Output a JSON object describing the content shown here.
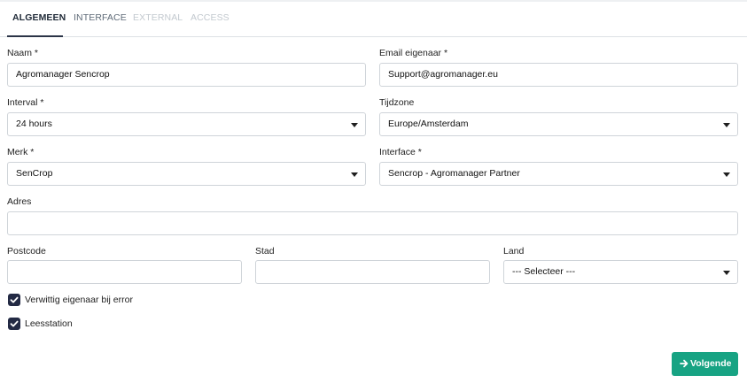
{
  "tabs": [
    {
      "label": "ALGEMEEN",
      "state": "active"
    },
    {
      "label": "INTERFACE",
      "state": "normal"
    },
    {
      "label": "EXTERNAL",
      "state": "disabled"
    },
    {
      "label": "ACCESS",
      "state": "disabled"
    }
  ],
  "form": {
    "naam": {
      "label": "Naam *",
      "value": "Agromanager Sencrop"
    },
    "email": {
      "label": "Email eigenaar *",
      "value": "Support@agromanager.eu"
    },
    "interval": {
      "label": "Interval *",
      "value": "24 hours"
    },
    "tijdzone": {
      "label": "Tijdzone",
      "value": "Europe/Amsterdam"
    },
    "merk": {
      "label": "Merk *",
      "value": "SenCrop"
    },
    "interface": {
      "label": "Interface *",
      "value": "Sencrop - Agromanager Partner"
    },
    "adres": {
      "label": "Adres",
      "value": ""
    },
    "postcode": {
      "label": "Postcode",
      "value": ""
    },
    "stad": {
      "label": "Stad",
      "value": ""
    },
    "land": {
      "label": "Land",
      "value": "--- Selecteer ---"
    }
  },
  "checkboxes": {
    "notify": {
      "label": "Verwittig eigenaar bij error",
      "checked": true
    },
    "reading": {
      "label": "Leesstation",
      "checked": true
    }
  },
  "actions": {
    "next_label": "Volgende"
  },
  "colors": {
    "primary": "#17a383",
    "checkbox": "#232a44",
    "tab_active": "#2b3447"
  }
}
